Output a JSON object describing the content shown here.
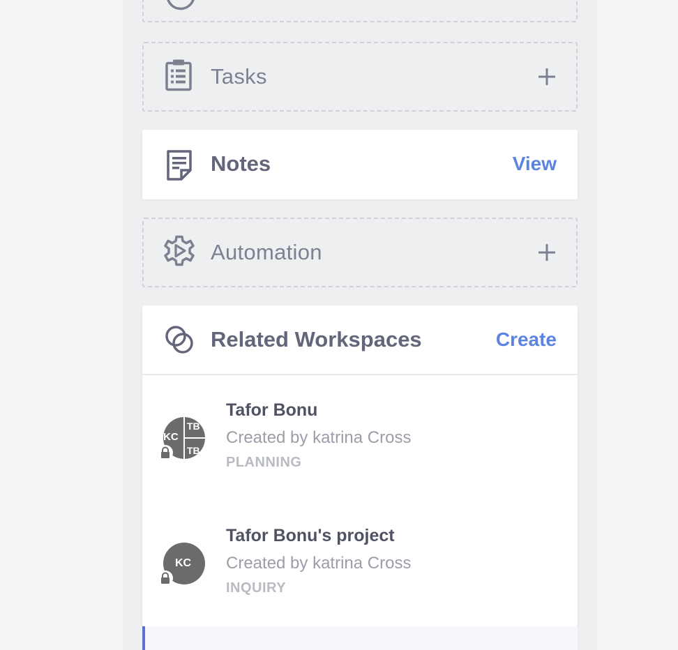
{
  "sections": {
    "tasks": {
      "label": "Tasks",
      "icon": "clipboard-icon",
      "action_icon": "plus-icon"
    },
    "notes": {
      "label": "Notes",
      "icon": "note-icon",
      "action": "View"
    },
    "automation": {
      "label": "Automation",
      "icon": "gear-play-icon",
      "action_icon": "plus-icon"
    },
    "related": {
      "label": "Related Workspaces",
      "icon": "linked-circles-icon",
      "action": "Create",
      "items": [
        {
          "title": "Tafor Bonu",
          "subtitle": "Created by katrina Cross",
          "status": "PLANNING",
          "avatar": {
            "left": "KC",
            "top_right": "TB",
            "bottom_right": "TB"
          }
        },
        {
          "title": "Tafor Bonu's project",
          "subtitle": "Created by katrina Cross",
          "status": "INQUIRY",
          "avatar": {
            "center": "KC"
          }
        }
      ]
    }
  },
  "colors": {
    "accent": "#5b84e0",
    "selected_bar": "#5b6fd6",
    "panel_bg": "#eeeff1",
    "avatar_bg": "#6b6b6b"
  }
}
